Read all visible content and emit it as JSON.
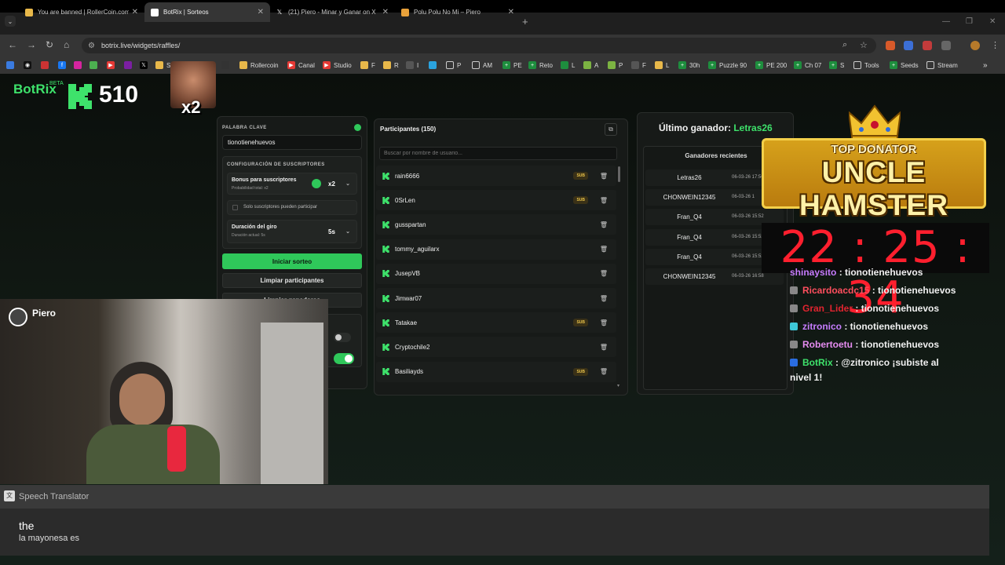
{
  "browser": {
    "tabs": [
      {
        "title": "You are banned | RollerCoin.com",
        "color": "#e8b84a"
      },
      {
        "title": "BotRix | Sorteos",
        "color": "#ffffff"
      },
      {
        "title": "(21) Piero - Minar y Ganar on X",
        "color": "#ffffff"
      },
      {
        "title": "Polu Polu No Mi – Piero",
        "color": "#e8a13a"
      }
    ],
    "url": "botrix.live/widgets/raffles/",
    "bookmarks": [
      "S",
      "Rollercoin",
      "Canal",
      "Studio",
      "F",
      "R",
      "I",
      "P",
      "AM",
      "PE",
      "Reto",
      "L",
      "A",
      "P",
      "F",
      "L",
      "30h",
      "Puzzle 90",
      "PE 200",
      "Ch 07",
      "S",
      "Tools",
      "Seeds",
      "Stream"
    ]
  },
  "overlay": {
    "brand": "BotRix",
    "beta": "BETA",
    "points": "510",
    "multiplier": "x2"
  },
  "raffle": {
    "keyword_label": "PALABRA CLAVE",
    "keyword_value": "tionotienehuevos",
    "subs_config_label": "CONFIGURACIÓN DE SUSCRIPTORES",
    "bonus_title": "Bonus para suscriptores",
    "bonus_sub": "Probabilidad total: x2",
    "bonus_value": "x2",
    "subs_only": "Solo suscriptores pueden participar",
    "spin_title": "Duración del giro",
    "spin_sub": "Duración actual: 5s",
    "spin_value": "5s",
    "start_btn": "Iniciar sorteo",
    "clear_btn": "Limpiar participantes",
    "clear_winners_btn": "Limpiar ganadores"
  },
  "participants": {
    "title": "Participantes (150)",
    "search_placeholder": "Buscar por nombre de usuario...",
    "rows": [
      {
        "name": "rain6666",
        "sub": "SUB"
      },
      {
        "name": "0SrLen",
        "sub": "SUB"
      },
      {
        "name": "gusspartan",
        "sub": ""
      },
      {
        "name": "tommy_aguilarx",
        "sub": ""
      },
      {
        "name": "JusepVB",
        "sub": ""
      },
      {
        "name": "Jimwar07",
        "sub": ""
      },
      {
        "name": "Tatakae",
        "sub": "SUB"
      },
      {
        "name": "Cryptochile2",
        "sub": ""
      },
      {
        "name": "Basiliayds",
        "sub": "SUB"
      }
    ]
  },
  "winners": {
    "last_label": "Último ganador:",
    "last_name": "Letras26",
    "recent_label": "Ganadores recientes",
    "rows": [
      {
        "name": "Letras26",
        "date": "06-03-26 17:56"
      },
      {
        "name": "CHONWEIN12345",
        "date": "06-03-26 1"
      },
      {
        "name": "Fran_Q4",
        "date": "06-03-26 15:52"
      },
      {
        "name": "Fran_Q4",
        "date": "06-03-26 15:52"
      },
      {
        "name": "Fran_Q4",
        "date": "06-03-26 15:52"
      },
      {
        "name": "CHONWEIN12345",
        "date": "06-03-26 16:58"
      }
    ]
  },
  "donator": {
    "top": "TOP DONATOR",
    "name": "UNCLE HAMSTER"
  },
  "timer": "22 : 25 : 34",
  "chat": [
    {
      "user": "shinaysito",
      "msg": " : tionotienehuevos",
      "color": "#c77dff"
    },
    {
      "user": "Ricardoacdc15",
      "msg": " : tionotienehuevos",
      "color": "#ff4f5e"
    },
    {
      "user": "Gran_Lider",
      "msg": " : tionotienehuevos",
      "color": "#e0242f"
    },
    {
      "user": "zitronico",
      "msg": " : tionotienehuevos",
      "color": "#c77dff"
    },
    {
      "user": "Robertoetu",
      "msg": " : tionotienehuevos",
      "color": "#e58cf0"
    },
    {
      "user": "BotRix",
      "msg": " : @zitronico ¡subiste al",
      "color": "#3ee26b"
    }
  ],
  "chat_wrap": "nivel 1!",
  "webcam": {
    "name": "Piero"
  },
  "translator": {
    "title": "Speech Translator",
    "main": "the",
    "sub": "la mayonesa es"
  }
}
